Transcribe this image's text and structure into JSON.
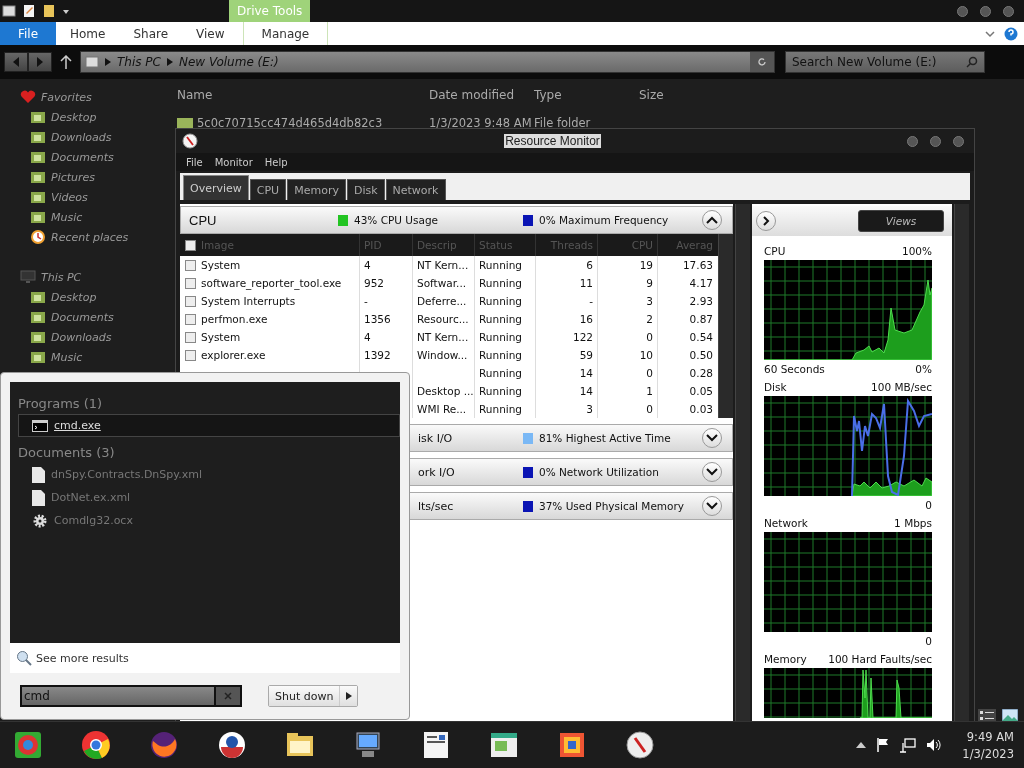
{
  "explorer": {
    "context_group": "Drive Tools",
    "ribbon_tabs": [
      {
        "label": "File",
        "kind": "file"
      },
      {
        "label": "Home",
        "kind": "tab"
      },
      {
        "label": "Share",
        "kind": "tab"
      },
      {
        "label": "View",
        "kind": "tab"
      },
      {
        "label": "Manage",
        "kind": "context"
      }
    ],
    "breadcrumb": [
      "This PC",
      "New Volume (E:)"
    ],
    "search": {
      "placeholder": "Search New Volume (E:)"
    },
    "navigation": [
      {
        "label": "Favorites",
        "kind": "favorites",
        "children": [
          {
            "label": "Desktop",
            "kind": "folder"
          },
          {
            "label": "Downloads",
            "kind": "folder"
          },
          {
            "label": "Documents",
            "kind": "folder"
          },
          {
            "label": "Pictures",
            "kind": "folder"
          },
          {
            "label": "Videos",
            "kind": "folder"
          },
          {
            "label": "Music",
            "kind": "folder"
          },
          {
            "label": "Recent places",
            "kind": "recent"
          }
        ]
      },
      {
        "label": "This PC",
        "kind": "computer",
        "children": [
          {
            "label": "Desktop",
            "kind": "folder"
          },
          {
            "label": "Documents",
            "kind": "folder"
          },
          {
            "label": "Downloads",
            "kind": "folder"
          },
          {
            "label": "Music",
            "kind": "folder"
          }
        ]
      }
    ],
    "columns": [
      "Name",
      "Date modified",
      "Type",
      "Size"
    ],
    "files": [
      {
        "name": "5c0c70715cc474d465d4db82c3",
        "date": "1/3/2023 9:48 AM",
        "type": "File folder"
      }
    ]
  },
  "resource_monitor": {
    "title": "Resource Monitor",
    "menu": [
      "File",
      "Monitor",
      "Help"
    ],
    "tabs": [
      {
        "label": "Overview",
        "selected": true
      },
      {
        "label": "CPU",
        "selected": false
      },
      {
        "label": "Memory",
        "selected": false
      },
      {
        "label": "Disk",
        "selected": false
      },
      {
        "label": "Network",
        "selected": false
      }
    ],
    "sections": [
      {
        "title": "CPU",
        "expanded": true,
        "stats": [
          {
            "label": "43% CPU Usage",
            "color": "#22c422"
          },
          {
            "label": "0% Maximum Frequency",
            "color": "#0a14b4"
          }
        ],
        "table": {
          "all_checked": false,
          "columns": [
            "Image",
            "PID",
            "Descrip",
            "Status",
            "Threads",
            "CPU",
            "Averag"
          ],
          "rows": [
            {
              "image": "System",
              "checked": false,
              "pid": "4",
              "description": "NT Kern...",
              "status": "Running",
              "threads": "6",
              "cpu": "19",
              "average": "17.63"
            },
            {
              "image": "software_reporter_tool.exe",
              "checked": false,
              "pid": "952",
              "description": "Softwar...",
              "status": "Running",
              "threads": "11",
              "cpu": "9",
              "average": "4.17"
            },
            {
              "image": "System Interrupts",
              "checked": false,
              "pid": "-",
              "description": "Deferre...",
              "status": "Running",
              "threads": "-",
              "cpu": "3",
              "average": "2.93"
            },
            {
              "image": "perfmon.exe",
              "checked": false,
              "pid": "1356",
              "description": "Resourc...",
              "status": "Running",
              "threads": "16",
              "cpu": "2",
              "average": "0.87"
            },
            {
              "image": "System",
              "checked": false,
              "pid": "4",
              "description": "NT Kern...",
              "status": "Running",
              "threads": "122",
              "cpu": "0",
              "average": "0.54"
            },
            {
              "image": "explorer.exe",
              "checked": false,
              "pid": "1392",
              "description": "Window...",
              "status": "Running",
              "threads": "59",
              "cpu": "10",
              "average": "0.50"
            },
            {
              "status": "Running",
              "threads": "14",
              "cpu": "0",
              "average": "0.28"
            },
            {
              "description": "Desktop ...",
              "status": "Running",
              "threads": "14",
              "cpu": "1",
              "average": "0.05"
            },
            {
              "description": "WMI Re...",
              "status": "Running",
              "threads": "3",
              "cpu": "0",
              "average": "0.03"
            }
          ]
        }
      },
      {
        "title": "isk I/O",
        "expanded": false,
        "stats": [
          {
            "label": "81% Highest Active Time",
            "color": "#7ab8f5"
          }
        ]
      },
      {
        "title": "ork I/O",
        "expanded": false,
        "stats": [
          {
            "label": "0% Network Utilization",
            "color": "#0a14b4"
          }
        ]
      },
      {
        "title": "lts/sec",
        "expanded": false,
        "stats": [
          {
            "label": "37% Used Physical Memory",
            "color": "#0a14b4"
          }
        ]
      }
    ],
    "views_button": "Views",
    "graphs": [
      {
        "kind": "cpu",
        "title": "CPU",
        "scale_max": "100%",
        "footer": "60 Seconds",
        "scale_min": "0%"
      },
      {
        "kind": "disk",
        "title": "Disk",
        "scale_max": "100 MB/sec",
        "scale_min": "0"
      },
      {
        "kind": "network",
        "title": "Network",
        "scale_max": "1 Mbps",
        "scale_min": "0"
      },
      {
        "kind": "memory",
        "title": "Memory",
        "scale_max": "100 Hard Faults/sec"
      }
    ]
  },
  "start_menu": {
    "groups": [
      {
        "heading": "Programs (1)",
        "items": [
          {
            "label": "cmd.exe",
            "kind": "console",
            "selected": true
          }
        ]
      },
      {
        "heading": "Documents (3)",
        "items": [
          {
            "label": "dnSpy.Contracts.DnSpy.xml",
            "kind": "document",
            "selected": false
          },
          {
            "label": "DotNet.ex.xml",
            "kind": "document",
            "selected": false
          },
          {
            "label": "Comdlg32.ocx",
            "kind": "gear",
            "selected": false
          }
        ]
      }
    ],
    "more_results": "See more results",
    "search": {
      "value": "cmd"
    },
    "shutdown": "Shut down"
  },
  "taskbar": {
    "time": "9:49 AM",
    "date": "1/3/2023"
  }
}
